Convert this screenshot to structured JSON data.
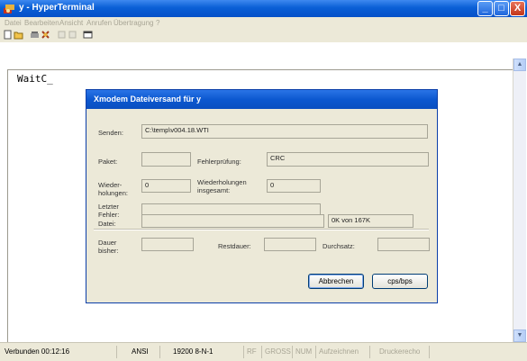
{
  "window": {
    "title": "y - HyperTerminal",
    "buttons": {
      "minimize": "_",
      "maximize": "□",
      "close": "X"
    }
  },
  "menu": [
    "Datei",
    "Bearbeiten",
    "Ansicht",
    "Anrufen",
    "Übertragung",
    "?"
  ],
  "toolbar": {
    "icons": [
      "new-icon",
      "open-icon",
      "phone-icon",
      "disconnect-icon",
      "send-icon",
      "receive-icon",
      "properties-icon"
    ]
  },
  "terminal": {
    "text": "WaitC_"
  },
  "dialog": {
    "title": "Xmodem Dateiversand für y",
    "send_label": "Senden:",
    "send_value": "C:\\temp\\v004.18.WTI",
    "packet_label": "Paket:",
    "packet_value": "",
    "error_check_label": "Fehlerprüfung:",
    "error_check_value": "CRC",
    "retries_label_1": "Wieder-",
    "retries_label_2": "holungen:",
    "retries_value": "0",
    "total_retries_label_1": "Wiederholungen",
    "total_retries_label_2": "insgesamt:",
    "total_retries_value": "0",
    "last_error_label_1": "Letzter",
    "last_error_label_2": "Fehler:",
    "last_error_value": "",
    "file_label": "Datei:",
    "file_progress_value": "",
    "file_progress_fraction": 0,
    "file_size_text": "0K von 167K",
    "elapsed_label_1": "Dauer",
    "elapsed_label_2": "bisher:",
    "elapsed_value": "",
    "remaining_label": "Restdauer:",
    "remaining_value": "",
    "throughput_label": "Durchsatz:",
    "throughput_value": "",
    "cancel_button": "Abbrechen",
    "cps_button": "cps/bps"
  },
  "statusbar": {
    "connected": "Verbunden 00:12:16",
    "emulation": "ANSI",
    "port_settings": "19200 8-N-1",
    "rf": "RF",
    "caps": "GROSS",
    "num": "NUM",
    "capture": "Aufzeichnen",
    "print_echo": "Druckerecho"
  },
  "colors": {
    "titlebar": "#0a5fd6",
    "dialog_bg": "#ece9d8",
    "disabled_text": "#a8a595"
  }
}
